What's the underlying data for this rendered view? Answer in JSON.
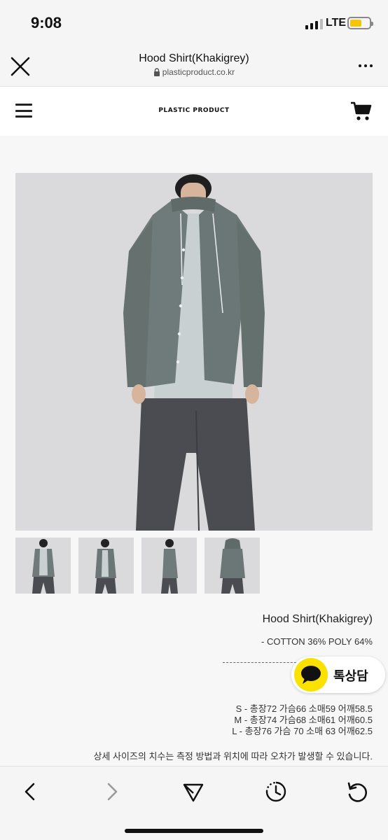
{
  "status_bar": {
    "time": "9:08",
    "network": "LTE",
    "signal_bars_active": 3,
    "battery_level": 0.6,
    "battery_color": "#f4c60b"
  },
  "browser": {
    "title": "Hood Shirt(Khakigrey)",
    "url": "plasticproduct.co.kr",
    "icons": [
      "close-icon",
      "lock-icon",
      "more-icon"
    ]
  },
  "site": {
    "logo": "PLASTIC  PRODUCT",
    "icons": [
      "hamburger-menu-icon",
      "cart-icon"
    ]
  },
  "product": {
    "name": "Hood Shirt(Khakigrey)",
    "material": "- COTTON 36% POLY 64%",
    "sizes": [
      "S - 총장72 가슴66 소매59 어깨58.5",
      "M - 총장74 가슴68 소매61 어깨60.5",
      "L - 총장76 가슴 70 소매 63 어깨62.5"
    ],
    "note": "상세 사이즈의 치수는 측정 방법과 위치에 따라 오차가 발생할 수 있습니다.",
    "thumbnail_count": 4
  },
  "chat_button": {
    "label": "톡상담",
    "color": "#fae100"
  },
  "toolbar": {
    "icons": [
      "back-icon",
      "forward-icon",
      "share-icon",
      "history-icon",
      "reload-icon"
    ]
  },
  "colors": {
    "shirt": "#6f7b7a",
    "pants": "#4a4c52",
    "tee": "#c8d0d2",
    "photo_bg": "#d9d9db"
  }
}
